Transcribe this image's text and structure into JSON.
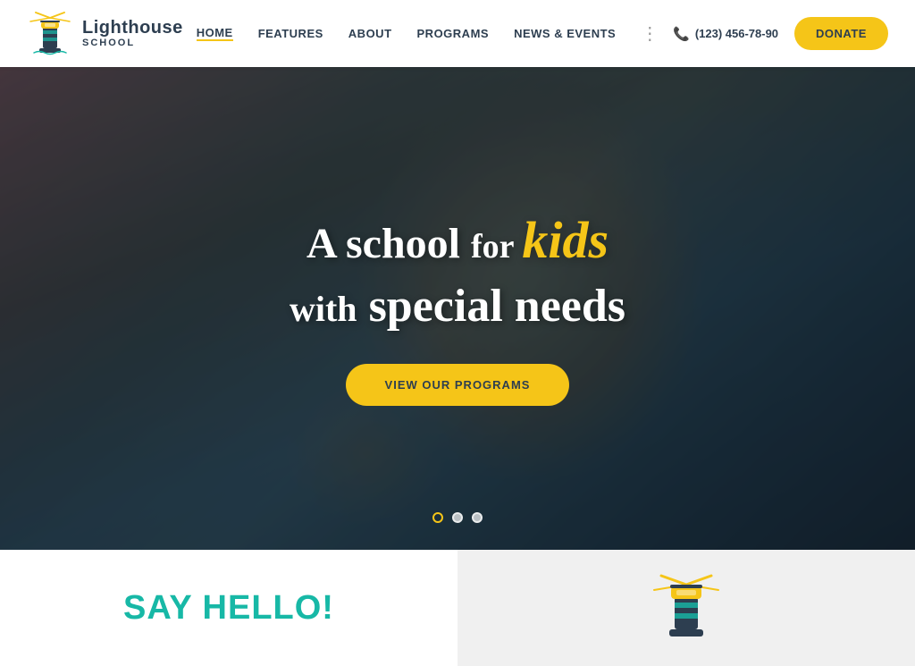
{
  "header": {
    "logo": {
      "title": "Lighthouse",
      "subtitle": "SCHOOL"
    },
    "nav": {
      "items": [
        {
          "label": "HOME",
          "active": true
        },
        {
          "label": "FEATURES",
          "active": false
        },
        {
          "label": "ABOUT",
          "active": false
        },
        {
          "label": "PROGRAMS",
          "active": false
        },
        {
          "label": "NEWS & EVENTS",
          "active": false
        }
      ],
      "more_icon": "⋮"
    },
    "phone": {
      "number": "(123) 456-78-90"
    },
    "donate_label": "DONATE"
  },
  "hero": {
    "line1_part1": "A school",
    "line1_for": "for",
    "line1_kids": "kids",
    "line2_with": "with",
    "line2_special": "special needs",
    "cta_button": "VIEW OUR PROGRAMS",
    "dots": [
      {
        "active": true
      },
      {
        "active": false
      },
      {
        "active": false
      }
    ]
  },
  "bottom": {
    "say_hello": "SAY HELLO!",
    "lighthouse_icon_label": "lighthouse-icon"
  }
}
